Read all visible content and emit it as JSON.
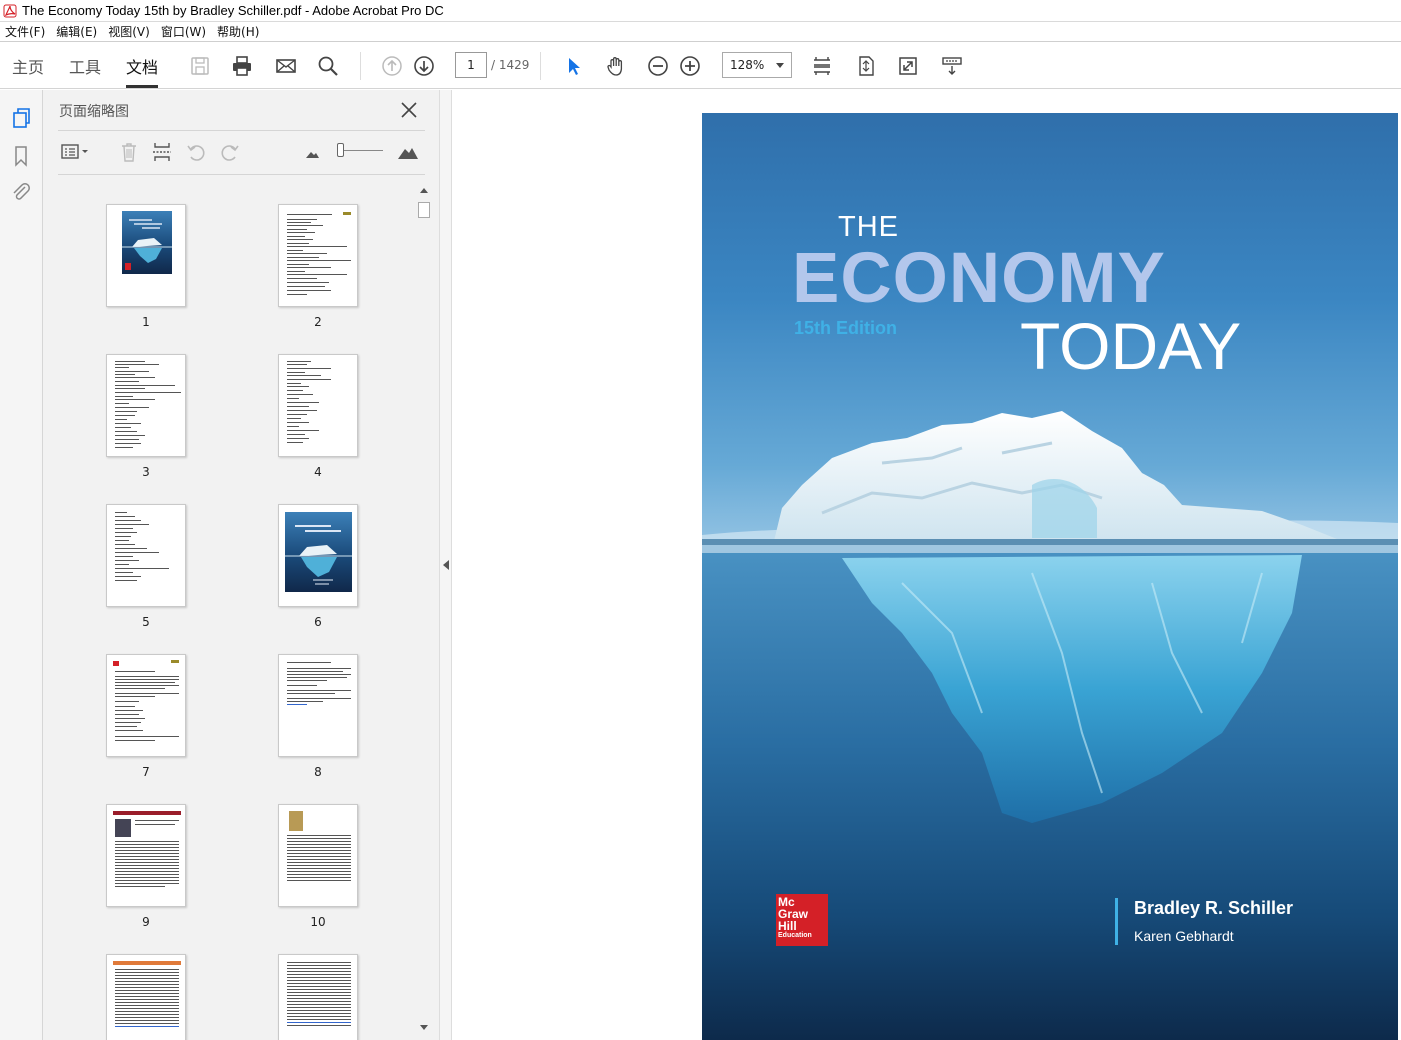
{
  "window": {
    "title": "The Economy Today 15th by Bradley Schiller.pdf - Adobe Acrobat Pro DC"
  },
  "menu": [
    "文件(F)",
    "编辑(E)",
    "视图(V)",
    "窗口(W)",
    "帮助(H)"
  ],
  "nav_tabs": {
    "home": "主页",
    "tools": "工具",
    "document": "文档"
  },
  "page_nav": {
    "current": "1",
    "total": "/ 1429"
  },
  "zoom": {
    "value": "128%"
  },
  "panel": {
    "title": "页面缩略图",
    "thumbnails": [
      "1",
      "2",
      "3",
      "4",
      "5",
      "6",
      "7",
      "8",
      "9",
      "10"
    ]
  },
  "cover": {
    "the": "THE",
    "economy": "ECONOMY",
    "edition": "15th Edition",
    "today": "TODAY",
    "logo_lines": [
      "Mc",
      "Graw",
      "Hill",
      "Education"
    ],
    "author1": "Bradley R. Schiller",
    "author2": "Karen Gebhardt"
  },
  "colors": {
    "accent": "#1473e6",
    "brand_red": "#d42027",
    "edition_blue": "#3fb1e6"
  }
}
